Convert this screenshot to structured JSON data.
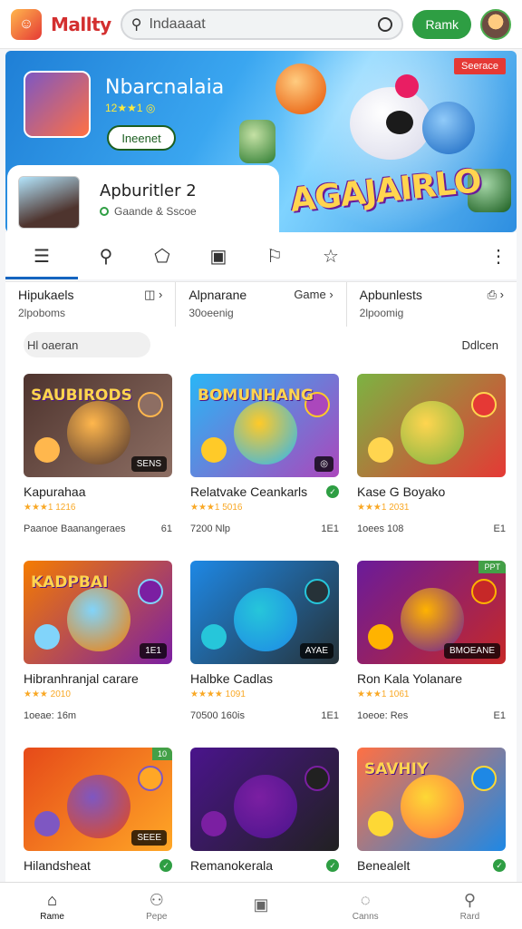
{
  "header": {
    "app_name": "Mallty",
    "search_value": "Indaaaat",
    "action_button": "Ramk"
  },
  "banner": {
    "title": "Nbarcnalaia",
    "rating": "12★★1 ◎",
    "button": "Ineenet",
    "ad_badge": "Seerace",
    "logo_text": "AGAJAIRLO"
  },
  "featured_app": {
    "title": "Apburitler 2",
    "subtitle": "Gaande & Sscoe"
  },
  "icon_tabs": [
    {
      "icon": "grid-icon",
      "glyph": "☰"
    },
    {
      "icon": "person-search-icon",
      "glyph": "⚲"
    },
    {
      "icon": "cap-icon",
      "glyph": "⬠"
    },
    {
      "icon": "calendar-icon",
      "glyph": "▣"
    },
    {
      "icon": "bookmark-icon",
      "glyph": "⚐"
    },
    {
      "icon": "star-icon",
      "glyph": "☆"
    }
  ],
  "categories": [
    {
      "title": "Hipukaels",
      "sub": "2lpoboms",
      "icon": "◫ ›"
    },
    {
      "title": "Alpnarane",
      "sub": "30oeenig",
      "icon": "Game ›"
    },
    {
      "title": "Apbunlests",
      "sub": "2lpoomig",
      "icon": "⎙ ›"
    }
  ],
  "filter": {
    "chip": "Hl oaeran",
    "sort": "Ddlcen"
  },
  "games": [
    {
      "title": "Kapurahaa",
      "rating": "★★★1 1216",
      "meta_left": "Paanoe Baanangeraes",
      "meta_right": "61",
      "thumb_text": "SAUBIRODS",
      "badge": "SENS",
      "colors": [
        "#4e342e",
        "#8d6e63",
        "#ffb74d"
      ]
    },
    {
      "title": "Relatvake Ceankarls",
      "rating": "★★★1 5016",
      "meta_left": "7200 Nlp",
      "meta_right": "1E1",
      "thumb_text": "BOMUNHANG",
      "badge": "◎",
      "colors": [
        "#29b6f6",
        "#ab47bc",
        "#ffca28"
      ],
      "verified": true
    },
    {
      "title": "Kase G Boyako",
      "rating": "★★★1 2031",
      "meta_left": "1oees 108",
      "meta_right": "E1",
      "thumb_text": "",
      "badge": "",
      "colors": [
        "#7cb342",
        "#e53935",
        "#ffd54f"
      ]
    },
    {
      "title": "Hibranhranjal carare",
      "rating": "★★★ 2010",
      "meta_left": "1oeae: 16m",
      "meta_right": "",
      "thumb_text": "KADPBAI",
      "badge": "1E1",
      "colors": [
        "#f57c00",
        "#7b1fa2",
        "#81d4fa"
      ]
    },
    {
      "title": "Halbke Cadlas",
      "rating": "★★★★ 1091",
      "meta_left": "70500 160is",
      "meta_right": "1E1",
      "thumb_text": "",
      "badge": "AYAE",
      "colors": [
        "#1e88e5",
        "#263238",
        "#26c6da"
      ]
    },
    {
      "title": "Ron Kala Yolanare",
      "rating": "★★★1 1061",
      "meta_left": "1oeoe: Res",
      "meta_right": "E1",
      "thumb_text": "",
      "badge": "BMOEANE",
      "colors": [
        "#6a1b9a",
        "#c62828",
        "#ffb300"
      ],
      "top_badge": "PPT"
    },
    {
      "title": "Hilandsheat",
      "rating": "",
      "meta_left": "",
      "meta_right": "",
      "thumb_text": "",
      "badge": "SEEE",
      "colors": [
        "#e64a19",
        "#ffa726",
        "#7e57c2"
      ],
      "verified": true,
      "top_badge": "10"
    },
    {
      "title": "Remanokerala",
      "rating": "",
      "meta_left": "",
      "meta_right": "",
      "thumb_text": "",
      "badge": "",
      "colors": [
        "#4a148c",
        "#212121",
        "#7b1fa2"
      ],
      "verified": true
    },
    {
      "title": "Benealelt",
      "rating": "",
      "meta_left": "",
      "meta_right": "",
      "thumb_text": "SAVHIY",
      "badge": "",
      "colors": [
        "#ff7043",
        "#1e88e5",
        "#fdd835"
      ],
      "verified": true
    }
  ],
  "bottom_nav": [
    {
      "label": "Rame",
      "icon": "home-icon",
      "glyph": "⌂",
      "active": true
    },
    {
      "label": "Pepe",
      "icon": "person-icon",
      "glyph": "⚇"
    },
    {
      "label": "",
      "icon": "calendar-icon",
      "glyph": "▣"
    },
    {
      "label": "Canns",
      "icon": "compass-icon",
      "glyph": "◌"
    },
    {
      "label": "Rard",
      "icon": "profile-icon",
      "glyph": "⚲"
    }
  ]
}
